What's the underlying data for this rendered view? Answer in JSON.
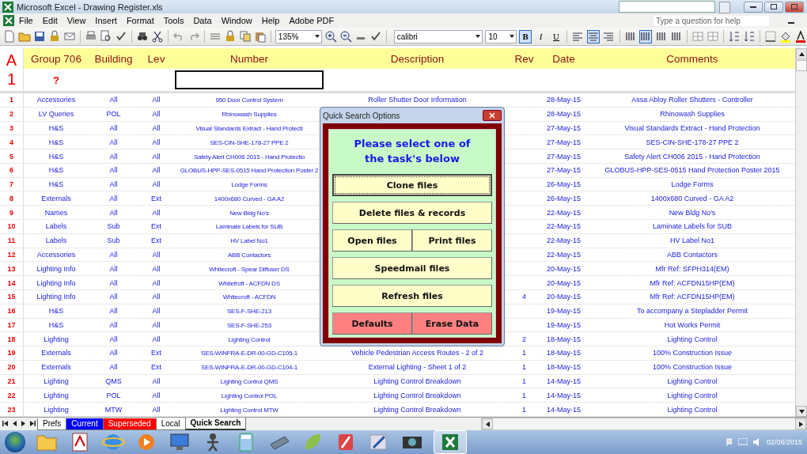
{
  "window": {
    "title": "Microsoft Excel - Drawing Register.xls"
  },
  "menu": [
    "File",
    "Edit",
    "View",
    "Insert",
    "Format",
    "Tools",
    "Data",
    "Window",
    "Help",
    "Adobe PDF"
  ],
  "help_box": {
    "placeholder": "Type a question for help"
  },
  "toolbar": {
    "zoom": "135%",
    "font": "calibri",
    "font_size": "10",
    "format_buttons": [
      {
        "label": "B",
        "selected": true
      },
      {
        "label": "I",
        "selected": false
      },
      {
        "label": "U",
        "selected": false
      }
    ],
    "align_buttons": [
      {
        "kind": "left",
        "selected": false
      },
      {
        "kind": "center",
        "selected": true
      },
      {
        "kind": "right",
        "selected": false
      }
    ],
    "column_buttons": [
      {
        "selected": false
      },
      {
        "selected": true
      },
      {
        "selected": false
      },
      {
        "selected": false
      }
    ]
  },
  "sheet": {
    "corner_column": "A",
    "corner_row": "1",
    "columns": [
      "Group 706",
      "Building",
      "Lev",
      "Number",
      "Description",
      "Rev",
      "Date",
      "Comments"
    ],
    "filter_group": "?",
    "rows": [
      {
        "num": "1",
        "group": "Accessories",
        "building": "All",
        "lev": "All",
        "number": "950 Door Control System",
        "description": "Roller Shutter Door Information",
        "date": "28-May-15",
        "comments": "Assa Abloy Roller Shutters - Controller"
      },
      {
        "num": "2",
        "group": "LV Queries",
        "building": "POL",
        "lev": "All",
        "number": "Rhinowash Supplies",
        "date": "28-May-15",
        "comments": "Rhinowash Supplies"
      },
      {
        "num": "3",
        "group": "H&S",
        "building": "All",
        "lev": "All",
        "number": "Visual Standards Extract - Hand Protecti",
        "date": "27-May-15",
        "comments": "Visual Standards Extract - Hand Protection"
      },
      {
        "num": "4",
        "group": "H&S",
        "building": "All",
        "lev": "All",
        "number": "SES-CIN-SHE-178-27 PPE 2",
        "date": "27-May-15",
        "comments": "SES-CIN-SHE-178-27 PPE 2"
      },
      {
        "num": "5",
        "group": "H&S",
        "building": "All",
        "lev": "All",
        "number": "Safety Alert CH006 2015 - Hand Protectio",
        "date": "27-May-15",
        "comments": "Safety Alert CH006 2015 - Hand Protection"
      },
      {
        "num": "6",
        "group": "H&S",
        "building": "All",
        "lev": "All",
        "number": "GLOBUS-HPP-SES-0515 Hand Protection Poster 2",
        "date": "27-May-15",
        "comments": "GLOBUS-HPP-SES-0515 Hand Protection Poster 2015"
      },
      {
        "num": "7",
        "group": "H&S",
        "building": "All",
        "lev": "All",
        "number": "Lodge Forms",
        "date": "26-May-15",
        "comments": "Lodge Forms"
      },
      {
        "num": "8",
        "group": "Externals",
        "building": "All",
        "lev": "Ext",
        "number": "1400x680 Curved - GA A2",
        "date": "26-May-15",
        "comments": "1400x680 Curved - GA A2"
      },
      {
        "num": "9",
        "group": "Names",
        "building": "All",
        "lev": "All",
        "number": "New Bldg No's",
        "date": "22-May-15",
        "comments": "New Bldg No's"
      },
      {
        "num": "10",
        "group": "Labels",
        "building": "Sub",
        "lev": "Ext",
        "number": "Laminate Labels for SUB",
        "date": "22-May-15",
        "comments": "Laminate Labels for SUB"
      },
      {
        "num": "11",
        "group": "Labels",
        "building": "Sub",
        "lev": "Ext",
        "number": "HV Label No1",
        "date": "22-May-15",
        "comments": "HV Label No1"
      },
      {
        "num": "12",
        "group": "Accessories",
        "building": "All",
        "lev": "All",
        "number": "ABB Contactors",
        "date": "22-May-15",
        "comments": "ABB Contactors"
      },
      {
        "num": "13",
        "group": "Lighting Info",
        "building": "All",
        "lev": "All",
        "number": "Whitecroft - Spear Diffuser DS",
        "date": "20-May-15",
        "comments": "Mfr Ref: SFPH314(EM)"
      },
      {
        "num": "14",
        "group": "Lighting Info",
        "building": "All",
        "lev": "All",
        "number": "Whitefroft - ACFDN DS",
        "date": "20-May-15",
        "comments": "Mfr Ref: ACFDN15HP(EM)"
      },
      {
        "num": "15",
        "group": "Lighting Info",
        "building": "All",
        "lev": "All",
        "number": "Whitecroft - ACFDN",
        "rev": "4",
        "date": "20-May-15",
        "comments": "Mfr Ref: ACFDN15HP(EM)"
      },
      {
        "num": "16",
        "group": "H&S",
        "building": "All",
        "lev": "All",
        "number": "SES-F-SHE-213",
        "date": "19-May-15",
        "comments": "To accompany a Stepladder Permit"
      },
      {
        "num": "17",
        "group": "H&S",
        "building": "All",
        "lev": "All",
        "number": "SES-F-SHE-253",
        "date": "19-May-15",
        "comments": "Hot Works Permit"
      },
      {
        "num": "18",
        "group": "Lighting",
        "building": "All",
        "lev": "All",
        "number": "Lighting Control",
        "rev": "2",
        "date": "18-May-15",
        "comments": "Lighting Control"
      },
      {
        "num": "19",
        "group": "Externals",
        "building": "All",
        "lev": "Ext",
        "number": "SES-WINFRA-E-DR-00-GD-C105-1",
        "description": "Vehicle Pedestrian Access Routes - 2 of 2",
        "rev": "1",
        "date": "18-May-15",
        "comments": "100% Construction Issue"
      },
      {
        "num": "20",
        "group": "Externals",
        "building": "All",
        "lev": "Ext",
        "number": "SES-WINFRA-E-DR-00-GD-C104-1",
        "description": "External Lighting - Sheet 1 of 2",
        "rev": "1",
        "date": "18-May-15",
        "comments": "100% Construction Issue"
      },
      {
        "num": "21",
        "group": "Lighting",
        "building": "QMS",
        "lev": "All",
        "number": "Lighting Control QMS",
        "description": "Lighting Control Breakdown",
        "rev": "1",
        "date": "14-May-15",
        "comments": "Lighting Control"
      },
      {
        "num": "22",
        "group": "Lighting",
        "building": "POL",
        "lev": "All",
        "number": "Lighting Control POL",
        "description": "Lighting Control Breakdown",
        "rev": "1",
        "date": "14-May-15",
        "comments": "Lighting Control"
      },
      {
        "num": "23",
        "group": "Lighting",
        "building": "MTW",
        "lev": "All",
        "number": "Lighting Control MTW",
        "description": "Lighting Control Breakdown",
        "rev": "1",
        "date": "14-May-15",
        "comments": "Lighting Control"
      }
    ]
  },
  "sheet_tabs": [
    {
      "label": "Prefs",
      "color": "#ffffff",
      "selected": false
    },
    {
      "label": "Current",
      "color": "#0000ff",
      "selected": false
    },
    {
      "label": "Superseded",
      "color": "#ff0000",
      "selected": false
    },
    {
      "label": "Local",
      "color": "#ffffff",
      "selected": false
    },
    {
      "label": "Quick Search",
      "color": "#ffffff",
      "selected": true
    }
  ],
  "dialog": {
    "title": "Quick Search Options",
    "prompt": "Please select one of the task's below",
    "button_rows": [
      [
        {
          "label": "Clone files",
          "kind": "task",
          "focused": true
        }
      ],
      [
        {
          "label": "Delete files & records",
          "kind": "task",
          "focused": false
        }
      ],
      [
        {
          "label": "Open files",
          "kind": "task",
          "focused": false
        },
        {
          "label": "Print files",
          "kind": "task",
          "focused": false
        }
      ],
      [
        {
          "label": "Speedmail files",
          "kind": "task",
          "focused": false
        }
      ],
      [
        {
          "label": "Refresh files",
          "kind": "task",
          "focused": false
        }
      ],
      [
        {
          "label": "Defaults",
          "kind": "reset",
          "focused": false
        },
        {
          "label": "Erase Data",
          "kind": "reset",
          "focused": false
        }
      ]
    ]
  },
  "taskbar": {
    "date": "02/06/2015"
  }
}
